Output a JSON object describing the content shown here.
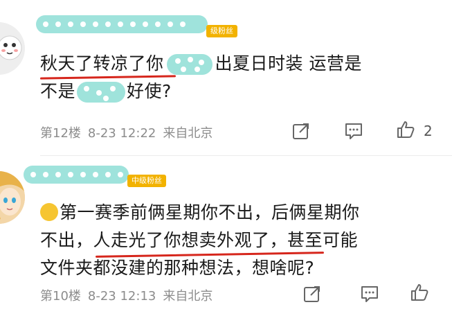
{
  "comments": [
    {
      "badge": "级粉丝",
      "lines": [
        {
          "pre": "秋天了转凉了你",
          "post": "出夏日时装 运营是"
        },
        {
          "pre": "不是",
          "post": "好使?"
        }
      ],
      "floor": "第12楼",
      "time": "8-23 12:22",
      "source": "来自北京",
      "likes": "2"
    },
    {
      "badge": "中级粉丝",
      "lines": [
        "第一赛季前俩星期你不出，后俩星期你",
        "不出，人走光了你想卖外观了，甚至可能",
        "文件夹都没建的那种想法，想啥呢?"
      ],
      "floor": "第10楼",
      "time": "8-23 12:13",
      "source": "来自北京",
      "likes": ""
    }
  ],
  "colors": {
    "mask": "#7fdad0",
    "badge": "#f2b200",
    "underline": "#d6261c",
    "meta": "#8c8c8c"
  },
  "icons": [
    "share-icon",
    "comment-icon",
    "like-icon"
  ]
}
